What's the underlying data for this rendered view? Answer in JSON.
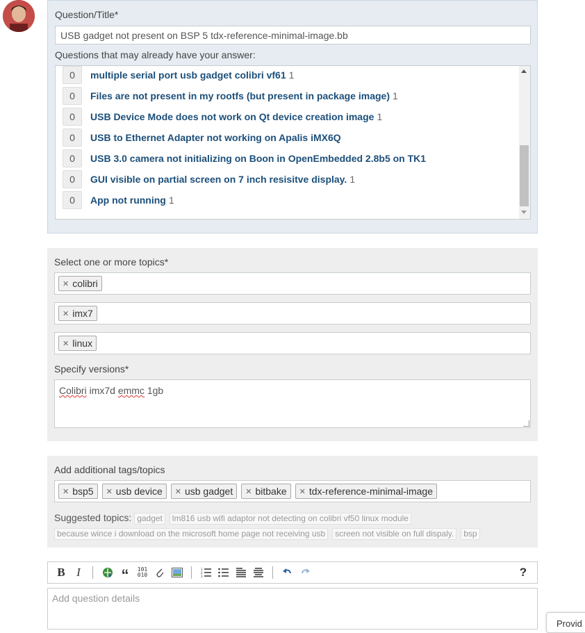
{
  "question": {
    "label": "Question/Title*",
    "value": "USB gadget not present on BSP 5 tdx-reference-minimal-image.bb",
    "similar_label": "Questions that may already have your answer:",
    "similar": [
      {
        "votes": "0",
        "title": "multiple serial port usb gadget colibri vf61",
        "count": "1"
      },
      {
        "votes": "0",
        "title": "Files are not present in my rootfs (but present in package image)",
        "count": "1"
      },
      {
        "votes": "0",
        "title": "USB Device Mode does not work on Qt device creation image",
        "count": "1"
      },
      {
        "votes": "0",
        "title": "USB to Ethernet Adapter not working on Apalis iMX6Q",
        "count": ""
      },
      {
        "votes": "0",
        "title": "USB 3.0 camera not initializing on Boon in OpenEmbedded 2.8b5 on TK1",
        "count": ""
      },
      {
        "votes": "0",
        "title": "GUI visible on partial screen on 7 inch resisitve display.",
        "count": "1"
      },
      {
        "votes": "0",
        "title": "App not running",
        "count": "1"
      }
    ]
  },
  "topics": {
    "label": "Select one or more topics*",
    "selected": [
      "colibri",
      "imx7",
      "linux"
    ],
    "versions_label": "Specify versions*",
    "versions_value_word1": "Colibri",
    "versions_value_word2": " imx7d ",
    "versions_value_word3": "emmc",
    "versions_value_word4": " 1gb"
  },
  "tags": {
    "label": "Add additional tags/topics",
    "items": [
      "bsp5",
      "usb device",
      "usb gadget",
      "bitbake",
      "tdx-reference-minimal-image"
    ],
    "suggested_label": "Suggested topics:",
    "suggested": [
      "gadget",
      "lm816 usb wifi adaptor not detecting on colibri vf50 linux module",
      "because wince i download on the microsoft home page not receiving usb",
      "screen not visible on full dispaly.",
      "bsp"
    ]
  },
  "editor": {
    "bold": "B",
    "italic": "I",
    "quote": "“",
    "binary": "101\n010",
    "help": "?",
    "placeholder": "Add question details"
  },
  "provide_button": "Provid",
  "colors": {
    "link": "#1c4f7a",
    "panel_blue": "#e6ecf2",
    "panel_gray": "#eeeeee"
  }
}
